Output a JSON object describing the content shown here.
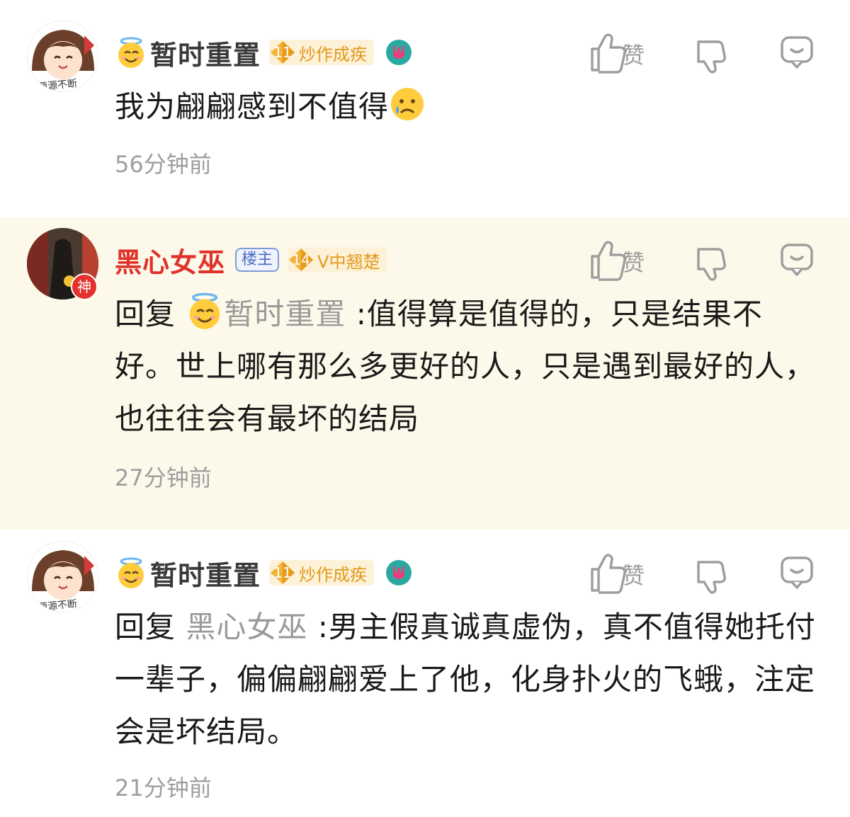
{
  "comments": [
    {
      "user": "暂时重置",
      "level": "11",
      "badge": "炒作成疾",
      "like_label": "赞",
      "text": "我为翩翩感到不值得",
      "time": "56分钟前",
      "avatar_caption": "源源不断"
    },
    {
      "user": "黑心女巫",
      "owner_tag": "楼主",
      "level": "14",
      "badge": "V中翘楚",
      "god_badge": "神",
      "like_label": "赞",
      "reply_prefix": "回复",
      "reply_to": "暂时重置",
      "text": ":值得算是值得的，只是结果不好。世上哪有那么多更好的人，只是遇到最好的人，也往往会有最坏的结局",
      "time": "27分钟前"
    },
    {
      "user": "暂时重置",
      "level": "11",
      "badge": "炒作成疾",
      "like_label": "赞",
      "reply_prefix": "回复",
      "reply_to": "黑心女巫",
      "text": ":男主假真诚真虚伪，真不值得她托付一辈子，偏偏翩翩爱上了他，化身扑火的飞蛾，注定会是坏结局。",
      "time": "21分钟前",
      "avatar_caption": "源源不断"
    }
  ],
  "colors": {
    "owner_name": "#e0312a",
    "level_badge": "#f2b43a",
    "highlight_bg": "#fdf9ea"
  }
}
